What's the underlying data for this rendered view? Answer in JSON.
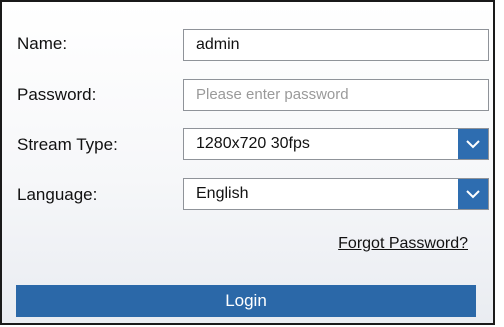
{
  "form": {
    "name": {
      "label": "Name:",
      "value": "admin"
    },
    "password": {
      "label": "Password:",
      "value": "",
      "placeholder": "Please enter password"
    },
    "stream_type": {
      "label": "Stream Type:",
      "selected": "1280x720 30fps",
      "icon": "chevron-down-icon"
    },
    "language": {
      "label": "Language:",
      "selected": "English",
      "icon": "chevron-down-icon"
    },
    "forgot_password_link": "Forgot Password?",
    "login_button": "Login"
  },
  "colors": {
    "accent": "#2b68a8",
    "border": "#1a1a1a"
  }
}
